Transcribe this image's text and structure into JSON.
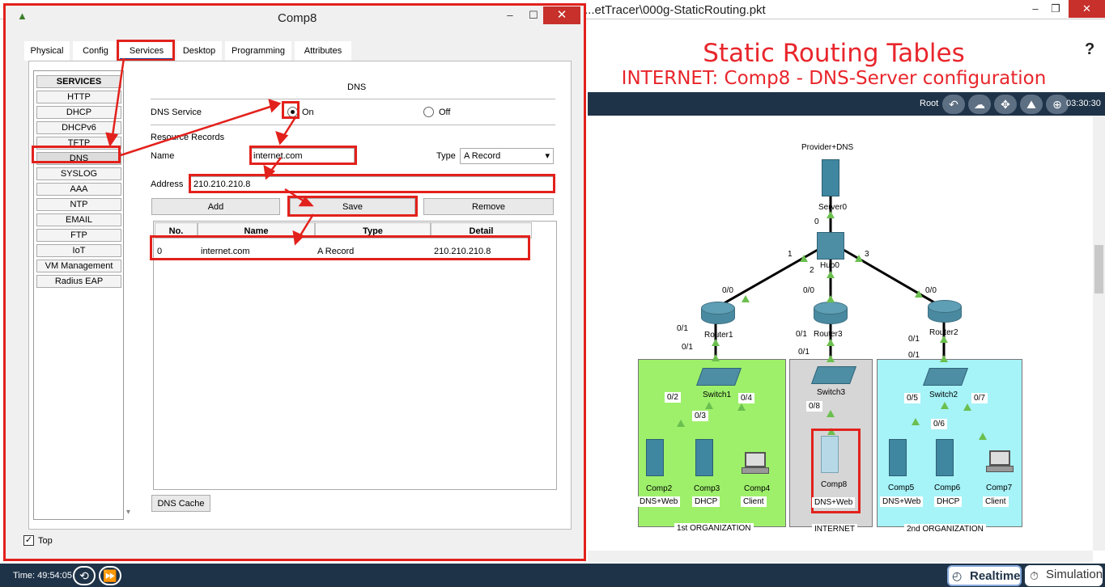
{
  "main_window": {
    "title": "...etTracer\\000g-StaticRouting.pkt",
    "minimize": "–",
    "restore": "❐",
    "close": "✕"
  },
  "banner": {
    "title": "Static Routing Tables",
    "subtitle": "INTERNET: Comp8 - DNS-Server configuration",
    "help": "?"
  },
  "toolbar": {
    "root_label": "Root",
    "clock": "03:30:30",
    "icons": [
      "back-icon",
      "cloud-icon",
      "move-icon",
      "image-icon",
      "cluster-icon"
    ]
  },
  "network": {
    "server0": {
      "title": "Provider+DNS",
      "name": "Server0",
      "port": "0"
    },
    "hub0": {
      "name": "Hub0",
      "ports": [
        "1",
        "2",
        "3"
      ]
    },
    "router1": {
      "name": "Router1",
      "port_top": "0/0",
      "port_bottom": "0/1"
    },
    "router3": {
      "name": "Router3",
      "port_top": "0/0",
      "port_bottom": "0/1"
    },
    "router2": {
      "name": "Router2",
      "port_top": "0/0",
      "port_bottom": "0/1"
    },
    "switch1": {
      "name": "Switch1",
      "port_up": "0/1",
      "ports": [
        "0/2",
        "0/3",
        "0/4"
      ]
    },
    "switch3": {
      "name": "Switch3",
      "port_up": "0/1",
      "ports": [
        "0/8"
      ]
    },
    "switch2": {
      "name": "Switch2",
      "port_up": "0/1",
      "ports": [
        "0/5",
        "0/6",
        "0/7"
      ]
    },
    "org1": {
      "label": "1st ORGANIZATION"
    },
    "internet": {
      "label": "INTERNET"
    },
    "org2": {
      "label": "2nd ORGANIZATION"
    },
    "hosts": [
      {
        "name": "Comp2",
        "role": "DNS+Web"
      },
      {
        "name": "Comp3",
        "role": "DHCP"
      },
      {
        "name": "Comp4",
        "role": "Client"
      },
      {
        "name": "Comp8",
        "role": "DNS+Web"
      },
      {
        "name": "Comp5",
        "role": "DNS+Web"
      },
      {
        "name": "Comp6",
        "role": "DHCP"
      },
      {
        "name": "Comp7",
        "role": "Client"
      }
    ]
  },
  "bottom": {
    "time": "Time: 49:54:05",
    "realtime": "Realtime",
    "simulation": "Simulation"
  },
  "dialog": {
    "title": "Comp8",
    "minimize": "–",
    "maximize": "☐",
    "close": "✕",
    "tabs": [
      "Physical",
      "Config",
      "Services",
      "Desktop",
      "Programming",
      "Attributes"
    ],
    "active_tab": "Services",
    "services_header": "SERVICES",
    "services": [
      "HTTP",
      "DHCP",
      "DHCPv6",
      "TFTP",
      "DNS",
      "SYSLOG",
      "AAA",
      "NTP",
      "EMAIL",
      "FTP",
      "IoT",
      "VM Management",
      "Radius EAP"
    ],
    "selected_service": "DNS",
    "dns": {
      "section_title": "DNS",
      "service_label": "DNS Service",
      "on_label": "On",
      "off_label": "Off",
      "resource_records": "Resource Records",
      "name_label": "Name",
      "name_value": "internet.com",
      "type_label": "Type",
      "type_value": "A Record",
      "address_label": "Address",
      "address_value": "210.210.210.8",
      "add_button": "Add",
      "save_button": "Save",
      "remove_button": "Remove",
      "columns": [
        "No.",
        "Name",
        "Type",
        "Detail"
      ],
      "rows": [
        {
          "no": "0",
          "name": "internet.com",
          "type": "A Record",
          "detail": "210.210.210.8"
        }
      ],
      "cache_button": "DNS Cache"
    },
    "top_checkbox_label": "Top"
  }
}
